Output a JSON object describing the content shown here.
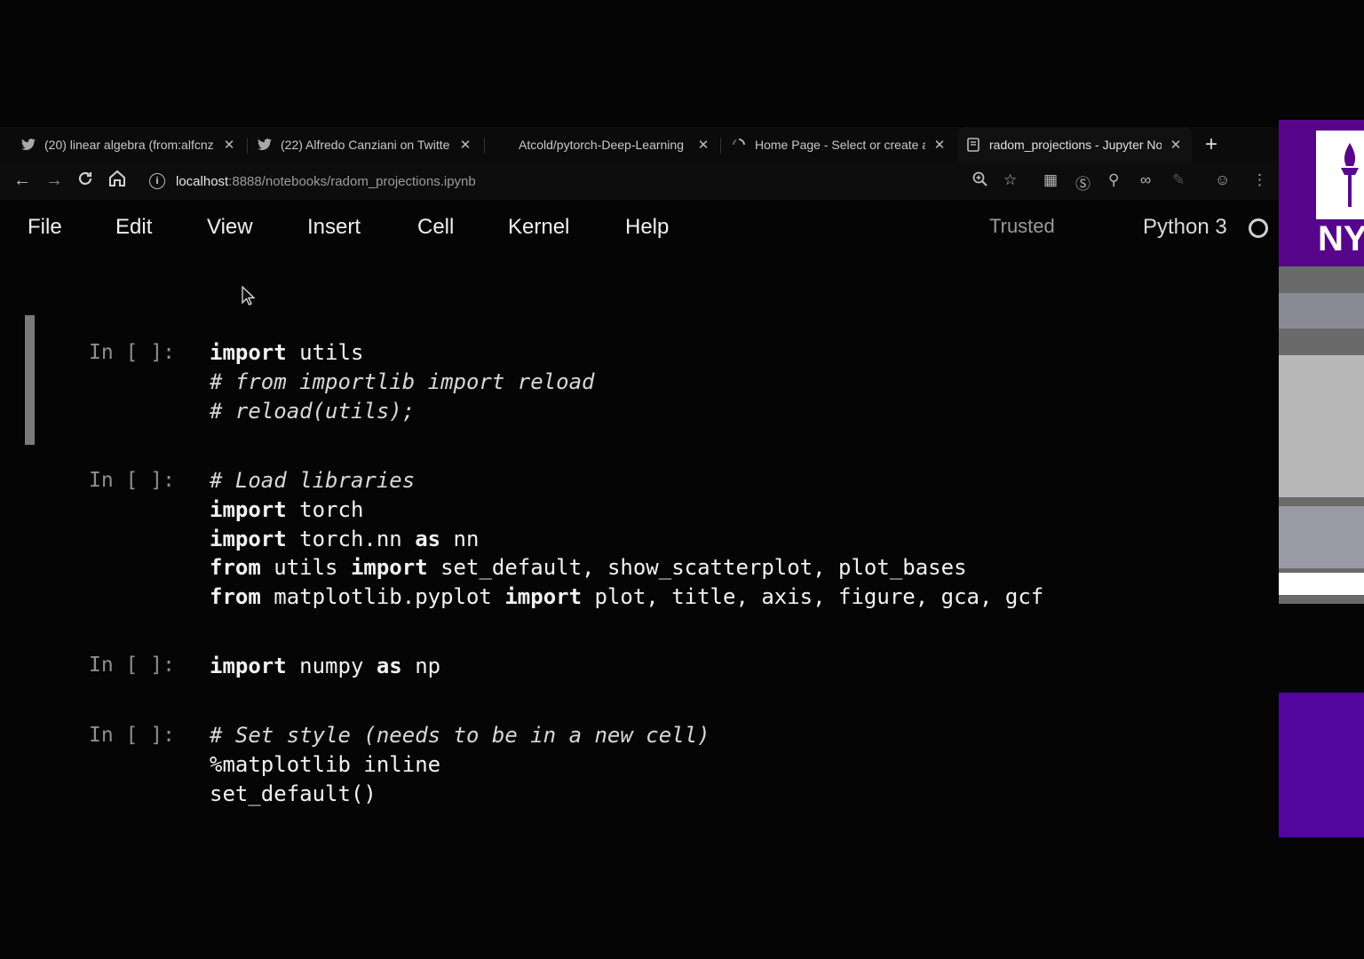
{
  "browser": {
    "tabs": [
      {
        "title": "(20) linear algebra (from:alfcnz",
        "icon": "twitter-icon"
      },
      {
        "title": "(22) Alfredo Canziani on Twitte",
        "icon": "twitter-icon"
      },
      {
        "title": "Atcold/pytorch-Deep-Learning",
        "icon": "github-icon"
      },
      {
        "title": "Home Page - Select or create a",
        "icon": "loading-icon"
      },
      {
        "title": "radom_projections - Jupyter No",
        "icon": "notebook-icon"
      }
    ],
    "url_host": "localhost",
    "url_path": ":8888/notebooks/radom_projections.ipynb"
  },
  "jupyter": {
    "menu": [
      "File",
      "Edit",
      "View",
      "Insert",
      "Cell",
      "Kernel",
      "Help"
    ],
    "trusted": "Trusted",
    "kernel": "Python 3"
  },
  "cells": [
    {
      "prompt": "In [ ]:",
      "lines": [
        [
          {
            "t": "import",
            "k": "kw"
          },
          {
            "t": " utils",
            "k": ""
          }
        ],
        [
          {
            "t": "# from importlib import reload",
            "k": "cm"
          }
        ],
        [
          {
            "t": "# reload(utils);",
            "k": "cm"
          }
        ]
      ]
    },
    {
      "prompt": "In [ ]:",
      "lines": [
        [
          {
            "t": "# Load libraries",
            "k": "cm"
          }
        ],
        [
          {
            "t": "import",
            "k": "kw"
          },
          {
            "t": " torch",
            "k": ""
          }
        ],
        [
          {
            "t": "import",
            "k": "kw"
          },
          {
            "t": " torch.nn ",
            "k": ""
          },
          {
            "t": "as",
            "k": "kw"
          },
          {
            "t": " nn",
            "k": ""
          }
        ],
        [
          {
            "t": "from",
            "k": "kw"
          },
          {
            "t": " utils ",
            "k": ""
          },
          {
            "t": "import",
            "k": "kw"
          },
          {
            "t": " set_default, show_scatterplot, plot_bases",
            "k": ""
          }
        ],
        [
          {
            "t": "from",
            "k": "kw"
          },
          {
            "t": " matplotlib.pyplot ",
            "k": ""
          },
          {
            "t": "import",
            "k": "kw"
          },
          {
            "t": " plot, title, axis, figure, gca, gcf",
            "k": ""
          }
        ]
      ]
    },
    {
      "prompt": "In [ ]:",
      "lines": [
        [
          {
            "t": "import",
            "k": "kw"
          },
          {
            "t": " numpy ",
            "k": ""
          },
          {
            "t": "as",
            "k": "kw"
          },
          {
            "t": " np",
            "k": ""
          }
        ]
      ]
    },
    {
      "prompt": "In [ ]:",
      "lines": [
        [
          {
            "t": "# Set style (needs to be in a new cell)",
            "k": "cm"
          }
        ],
        [
          {
            "t": "%matplotlib inline",
            "k": ""
          }
        ],
        [
          {
            "t": "set_default()",
            "k": ""
          }
        ]
      ]
    }
  ],
  "overlay": {
    "logo_text": "NY"
  }
}
